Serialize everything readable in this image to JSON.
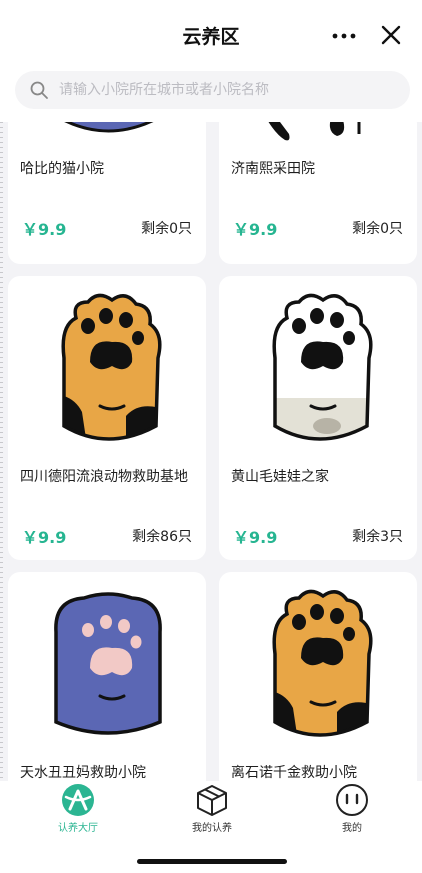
{
  "header": {
    "title": "云养区",
    "more_icon": "more-horizontal-icon",
    "close_icon": "close-icon"
  },
  "search": {
    "placeholder": "请输入小院所在城市或者小院名称",
    "icon": "search-icon"
  },
  "cards": [
    {
      "name": "哈比的猫小院",
      "price": "￥9.9",
      "stock": "剩余0只",
      "paw": "blue-paw"
    },
    {
      "name": "济南熙采田院",
      "price": "￥9.9",
      "stock": "剩余0只",
      "paw": "calico-paw"
    },
    {
      "name": "四川德阳流浪动物救助基地",
      "price": "￥9.9",
      "stock": "剩余86只",
      "paw": "orange-tortie-paw"
    },
    {
      "name": "黄山毛娃娃之家",
      "price": "￥9.9",
      "stock": "剩余3只",
      "paw": "white-calico-paw"
    },
    {
      "name": "天水丑丑妈救助小院",
      "price": "",
      "stock": "",
      "paw": "blue-paw"
    },
    {
      "name": "离石诺千金救助小院",
      "price": "",
      "stock": "",
      "paw": "orange-tortie-paw"
    }
  ],
  "tabbar": {
    "tabs": [
      {
        "label": "认养大厅",
        "icon": "adopt-hall-icon",
        "active": true
      },
      {
        "label": "我的认养",
        "icon": "box-icon",
        "active": false
      },
      {
        "label": "我的",
        "icon": "face-icon",
        "active": false
      }
    ]
  },
  "colors": {
    "accent": "#2bb592",
    "price": "#26b591",
    "page_bg": "#f3f3f6",
    "paw_orange": "#e8a646",
    "paw_blue": "#5b67b4"
  }
}
